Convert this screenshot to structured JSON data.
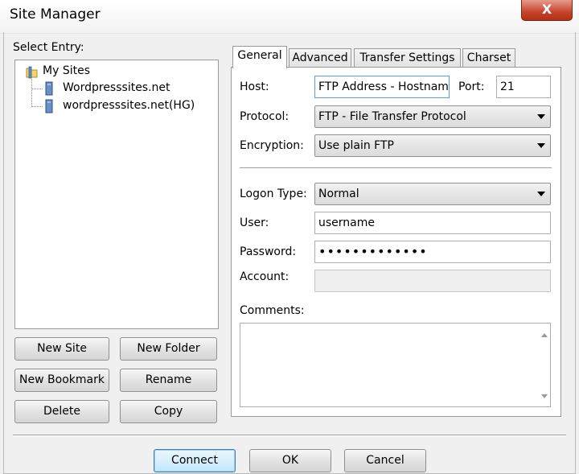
{
  "window": {
    "title": "Site Manager",
    "close_glyph": "X"
  },
  "left": {
    "select_label": "Select Entry:",
    "tree": {
      "root": "My Sites",
      "items": [
        "Wordpresssites.net",
        "wordpresssites.net(HG)"
      ]
    },
    "buttons": {
      "new_site": "New Site",
      "new_folder": "New Folder",
      "new_bookmark": "New Bookmark",
      "rename": "Rename",
      "delete": "Delete",
      "copy": "Copy"
    }
  },
  "tabs": [
    "General",
    "Advanced",
    "Transfer Settings",
    "Charset"
  ],
  "general": {
    "host_label": "Host:",
    "host_value": "FTP Address - Hostname",
    "port_label": "Port:",
    "port_value": "21",
    "protocol_label": "Protocol:",
    "protocol_value": "FTP - File Transfer Protocol",
    "encryption_label": "Encryption:",
    "encryption_value": "Use plain FTP",
    "logon_label": "Logon Type:",
    "logon_value": "Normal",
    "user_label": "User:",
    "user_value": "username",
    "password_label": "Password:",
    "password_value": "•••••••••••••",
    "account_label": "Account:",
    "account_value": "",
    "comments_label": "Comments:"
  },
  "footer": {
    "connect": "Connect",
    "ok": "OK",
    "cancel": "Cancel"
  },
  "colors": {
    "close_button": "#c7432b",
    "default_button_border": "#3c7fb1",
    "focus_border": "#569de5"
  }
}
